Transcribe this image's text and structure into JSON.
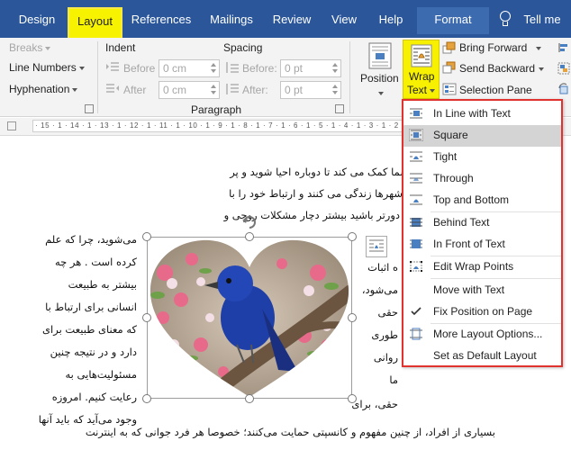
{
  "tabs": [
    {
      "label": "Design"
    },
    {
      "label": "Layout"
    },
    {
      "label": "References"
    },
    {
      "label": "Mailings"
    },
    {
      "label": "Review"
    },
    {
      "label": "View"
    },
    {
      "label": "Help"
    },
    {
      "label": "Format"
    }
  ],
  "tell_me": "Tell me",
  "ribbon": {
    "breaks": "Breaks",
    "line_numbers": "Line Numbers",
    "hyphenation": "Hyphenation",
    "indent_title": "Indent",
    "indent_before_label": "Before",
    "indent_before_value": "0 cm",
    "indent_after_label": "After",
    "indent_after_value": "0 cm",
    "spacing_title": "Spacing",
    "spacing_before_label": "Before:",
    "spacing_before_value": "0 pt",
    "spacing_after_label": "After:",
    "spacing_after_value": "0 pt",
    "paragraph_group": "Paragraph",
    "position": "Position",
    "wrap_line1": "Wrap",
    "wrap_line2": "Text",
    "bring_forward": "Bring Forward",
    "send_backward": "Send Backward",
    "selection_pane": "Selection Pane"
  },
  "ruler": {
    "ticks": "· 15 · 1 · 14 · 1 · 13 · 1 · 12 · 1 · 11 · 1 · 10 · 1 · 9 · 1 · 8 · 1 · 7 · 1 · 6 · 1 · 5 · 1 · 4 · 1 · 3 · 1 · 2 · 1 · 1 · 1 · 1 ·"
  },
  "wrap_menu": {
    "items": [
      {
        "label": "In Line with Text",
        "icon": "inline-icon"
      },
      {
        "label": "Square",
        "icon": "square-wrap-icon",
        "selected": true
      },
      {
        "label": "Tight",
        "icon": "tight-wrap-icon"
      },
      {
        "label": "Through",
        "icon": "through-wrap-icon"
      },
      {
        "label": "Top and Bottom",
        "icon": "top-bottom-wrap-icon"
      },
      {
        "label": "Behind Text",
        "icon": "behind-text-icon"
      },
      {
        "label": "In Front of Text",
        "icon": "in-front-text-icon"
      },
      {
        "label": "Edit Wrap Points",
        "icon": "edit-wrap-points-icon"
      },
      {
        "label": "Move with Text",
        "icon": ""
      },
      {
        "label": "Fix Position on Page",
        "icon": "checkmark-icon"
      },
      {
        "label": "More Layout Options...",
        "icon": "layout-options-icon"
      },
      {
        "label": "Set as Default Layout",
        "icon": ""
      }
    ]
  },
  "document": {
    "lines": [
      "حافظه شما را بهبود می بخشد و به شما کمک می کند تا دوباره احیا شوید و پر",
      "ژی بازگردید . بیشتر جوامع بشری در شهرها زندگی می کنند و ارتباط خود را با",
      "فته اند. هر چه قدر که شما از طبیعت دورتر باشید بیشتر دچار مشکلات روحی و",
      "می‌شوید، چرا که علم",
      "کرده است . هر چه",
      "بیشتر به طبیعت",
      "انسانی برای ارتباط با",
      "که معنای طبیعت برای",
      "دارد و در نتیجه چنین",
      "مسئولیت‌هایی به",
      "رعایت کنیم. امروزه",
      "وجود می‌آید که باید آنها",
      "بسیاری از افراد، از چنین مفهوم و کانسپتی حمایت می‌کنند؛ خصوصا هر فرد جوانی که به اینترنت"
    ],
    "right_lines": [
      "ه اثبات",
      "می‌شود،",
      "حقی",
      "طوری",
      "روانی",
      "ما",
      "حقی، برای"
    ]
  },
  "colors": {
    "title_bar": "#2b579a",
    "accent_yellow": "#f7f000",
    "menu_border": "#e0332f"
  }
}
